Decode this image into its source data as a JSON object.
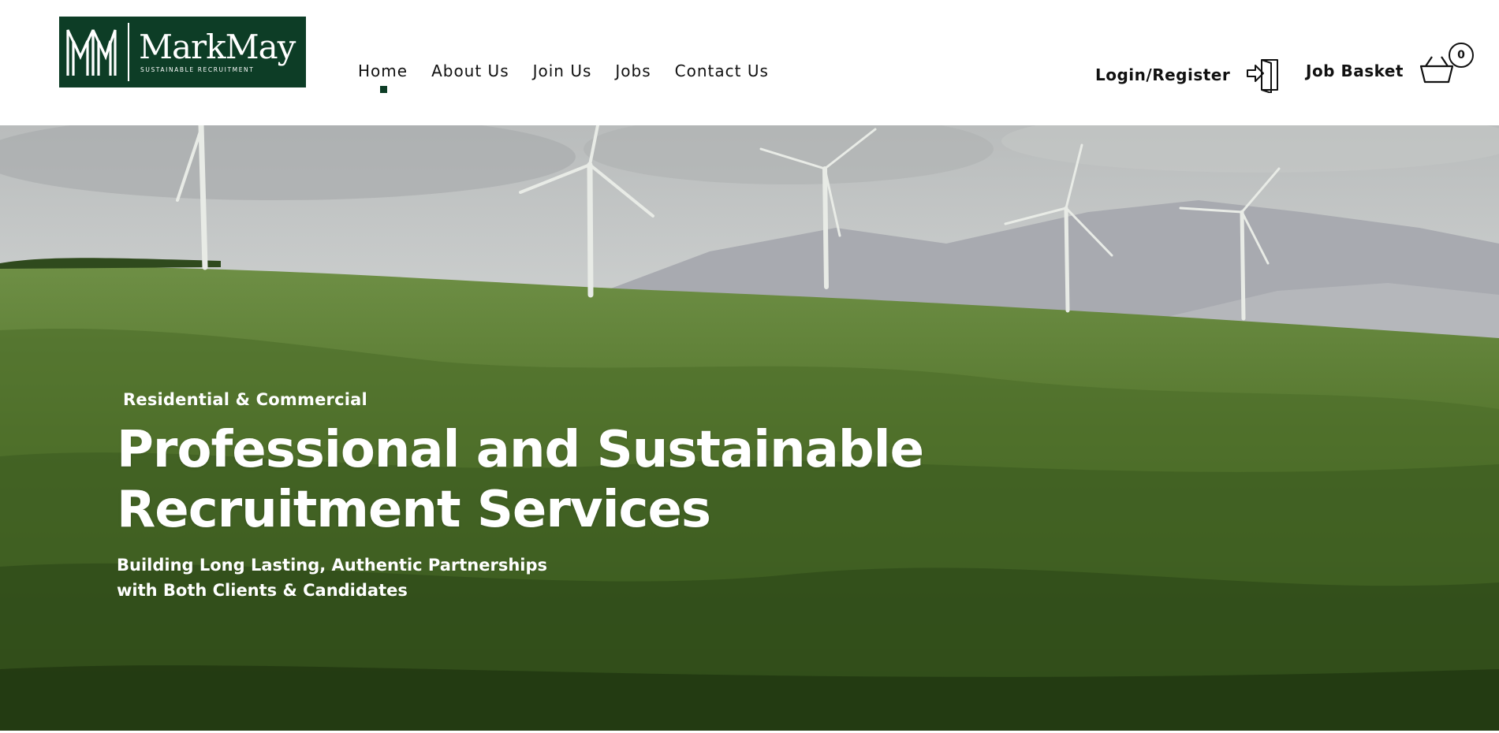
{
  "brand": {
    "name": "MarkMay",
    "tagline": "SUSTAINABLE RECRUITMENT",
    "color": "#0d3d26"
  },
  "nav": {
    "items": [
      {
        "label": "Home",
        "active": true
      },
      {
        "label": "About Us",
        "active": false
      },
      {
        "label": "Join Us",
        "active": false
      },
      {
        "label": "Jobs",
        "active": false
      },
      {
        "label": "Contact Us",
        "active": false
      }
    ]
  },
  "auth": {
    "label": "Login/Register",
    "icon": "login-door-icon"
  },
  "basket": {
    "label": "Job Basket",
    "count": "0",
    "icon": "basket-icon"
  },
  "hero": {
    "kicker": "Residential & Commercial",
    "title_line1": "Professional and Sustainable",
    "title_line2": "Recruitment Services",
    "subtitle_line1": "Building Long Lasting, Authentic Partnerships",
    "subtitle_line2": "with Both Clients & Candidates"
  }
}
